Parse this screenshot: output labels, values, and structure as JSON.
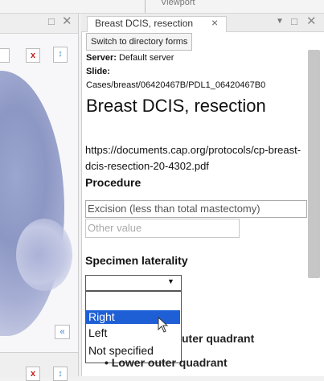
{
  "viewport": {
    "label": "Viewport"
  },
  "window_controls": {
    "maximize": "□",
    "close": "✕",
    "menu": "▼"
  },
  "slide_viewer": {
    "zoom_x_label": "x",
    "zoom_arrow_label": "↕",
    "collapse_label": "«"
  },
  "tab": {
    "title": "Breast DCIS, resection",
    "close": "×"
  },
  "panel": {
    "switch_button": "Switch to directory forms",
    "server_label": "Server:",
    "server_value": "Default server",
    "slide_label": "Slide:",
    "slide_path": "Cases/breast/06420467B/PDL1_06420467B0",
    "form_title": "Breast DCIS, resection",
    "protocol_url": "https://documents.cap.org/protocols/cp-breast-dcis-resection-20-4302.pdf",
    "procedure_label": "Procedure",
    "procedure_value": "Excision (less than total mastectomy)",
    "other_value_placeholder": "Other value",
    "laterality_label": "Specimen laterality",
    "laterality_caret": "▼",
    "laterality_options": [
      "",
      "Right",
      "Left",
      "Not specified"
    ],
    "laterality_highlighted": "Right",
    "hidden_item_1": "uter quadrant",
    "hidden_item_2": "Lower outer quadrant",
    "hidden_item_2_prefix": "•"
  }
}
